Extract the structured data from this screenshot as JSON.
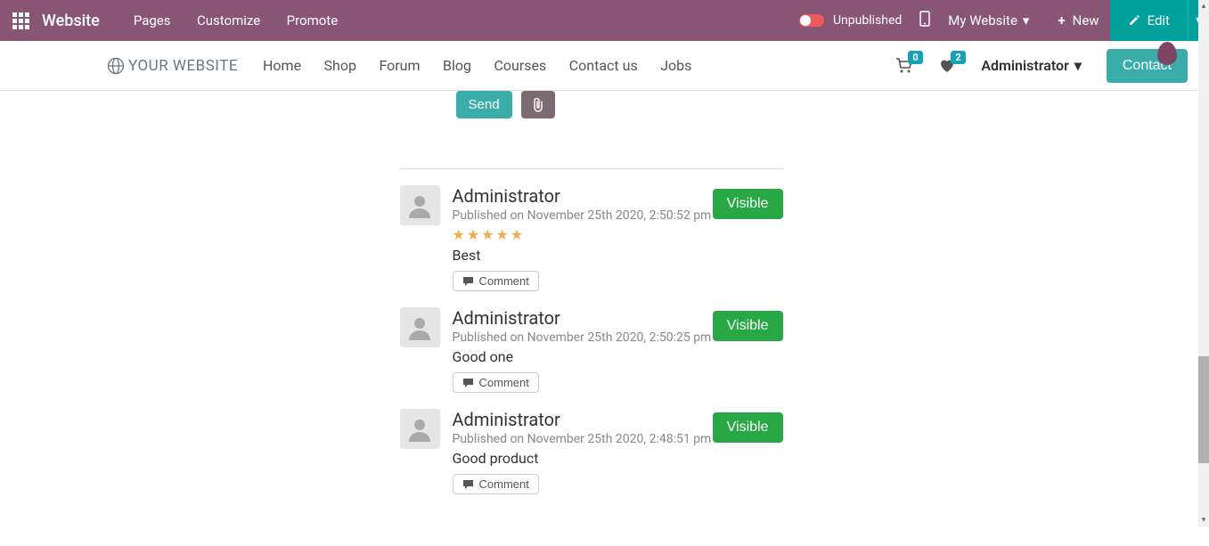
{
  "topbar": {
    "brand": "Website",
    "menu": [
      "Pages",
      "Customize",
      "Promote"
    ],
    "publish_status": "Unpublished",
    "website_dd": "My Website",
    "new_label": "New",
    "edit_label": "Edit"
  },
  "navbar": {
    "logo_text": "YOUR WEBSITE",
    "items": [
      "Home",
      "Shop",
      "Forum",
      "Blog",
      "Courses",
      "Contact us",
      "Jobs"
    ],
    "cart_count": "0",
    "wish_count": "2",
    "user": "Administrator",
    "contact_label": "Contact"
  },
  "compose": {
    "send_label": "Send"
  },
  "visible_label": "Visible",
  "comment_action_label": "Comment",
  "comments": [
    {
      "author": "Administrator",
      "published": "Published on November 25th 2020, 2:50:52 pm",
      "stars": 5,
      "text": "Best"
    },
    {
      "author": "Administrator",
      "published": "Published on November 25th 2020, 2:50:25 pm",
      "stars": 0,
      "text": "Good one"
    },
    {
      "author": "Administrator",
      "published": "Published on November 25th 2020, 2:48:51 pm",
      "stars": 0,
      "text": "Good product"
    }
  ]
}
